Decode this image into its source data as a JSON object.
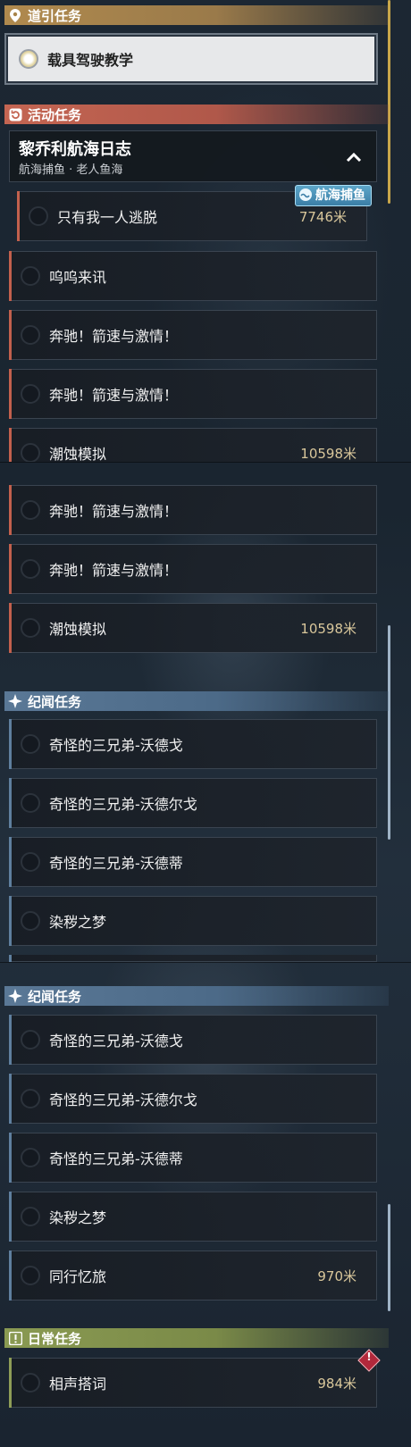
{
  "sections": {
    "guide": {
      "title": "道引任务",
      "icon": "map-pin-icon"
    },
    "event": {
      "title": "活动任务",
      "icon": "refresh-icon"
    },
    "lore1": {
      "title": "纪闻任务",
      "icon": "sparkle-icon"
    },
    "lore2": {
      "title": "纪闻任务",
      "icon": "sparkle-icon"
    },
    "daily": {
      "title": "日常任务",
      "icon": "alert-icon"
    }
  },
  "guide_quest": {
    "label": "载具驾驶教学"
  },
  "event_group": {
    "title": "黎乔利航海日志",
    "subtitle": "航海捕鱼 · 老人鱼海",
    "tag": "航海捕鱼"
  },
  "event_quests": [
    {
      "label": "只有我一人逃脱",
      "distance": "7746米"
    },
    {
      "label": "呜呜来讯",
      "distance": ""
    },
    {
      "label": "奔驰！箭速与激情！",
      "distance": ""
    },
    {
      "label": "奔驰！箭速与激情！",
      "distance": ""
    },
    {
      "label": "潮蚀模拟",
      "distance": "10598米"
    },
    {
      "label": "奔驰！箭速与激情！",
      "distance": ""
    },
    {
      "label": "奔驰！箭速与激情！",
      "distance": ""
    },
    {
      "label": "潮蚀模拟",
      "distance": "10598米"
    }
  ],
  "lore_quests_1": [
    {
      "label": "奇怪的三兄弟-沃德戈"
    },
    {
      "label": "奇怪的三兄弟-沃德尔戈"
    },
    {
      "label": "奇怪的三兄弟-沃德蒂"
    },
    {
      "label": "染秽之梦"
    }
  ],
  "lore_quests_2": [
    {
      "label": "奇怪的三兄弟-沃德戈",
      "distance": ""
    },
    {
      "label": "奇怪的三兄弟-沃德尔戈",
      "distance": ""
    },
    {
      "label": "奇怪的三兄弟-沃德蒂",
      "distance": ""
    },
    {
      "label": "染秽之梦",
      "distance": ""
    },
    {
      "label": "同行忆旅",
      "distance": "970米"
    }
  ],
  "daily_quests": [
    {
      "label": "相声搭词",
      "distance": "984米"
    }
  ],
  "colors": {
    "guide": "#b08a4e",
    "event": "#c46552",
    "lore": "#5a7896",
    "daily": "#8a9a52",
    "distance_text": "#d9c79b"
  }
}
